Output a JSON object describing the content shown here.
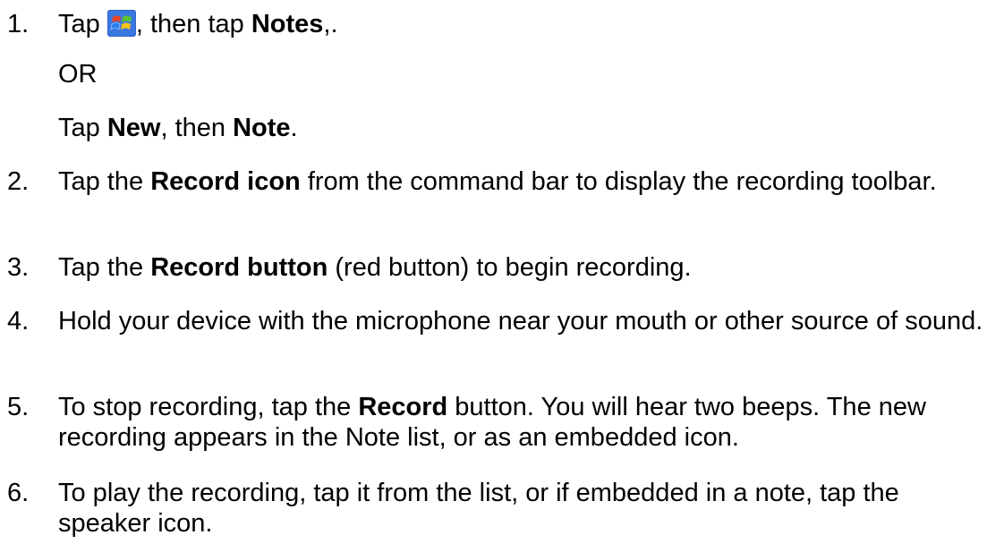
{
  "steps": [
    {
      "num": "1.",
      "parts": [
        "Tap ",
        "",
        ", then tap ",
        "Notes",
        ",."
      ]
    },
    {
      "num": "2.",
      "parts": [
        "Tap the ",
        "Record icon",
        " from the command bar to display the recording toolbar."
      ]
    },
    {
      "num": "3.",
      "parts": [
        "Tap the ",
        "Record button",
        " (red button) to begin recording."
      ]
    },
    {
      "num": "4.",
      "text": "Hold your device with the microphone near your mouth or other source of sound."
    },
    {
      "num": "5.",
      "parts": [
        "To stop recording, tap the ",
        "Record",
        " button. You will hear two beeps. The new recording appears in the Note list, or as an embedded icon."
      ]
    },
    {
      "num": "6.",
      "text": "To play the recording, tap it from the list, or if embedded in a note, tap the speaker icon."
    }
  ],
  "step1_or": "OR",
  "step1_alt": [
    "Tap ",
    "New",
    ", then ",
    "Note",
    "."
  ],
  "icons": {
    "start": "windows-start-icon"
  }
}
